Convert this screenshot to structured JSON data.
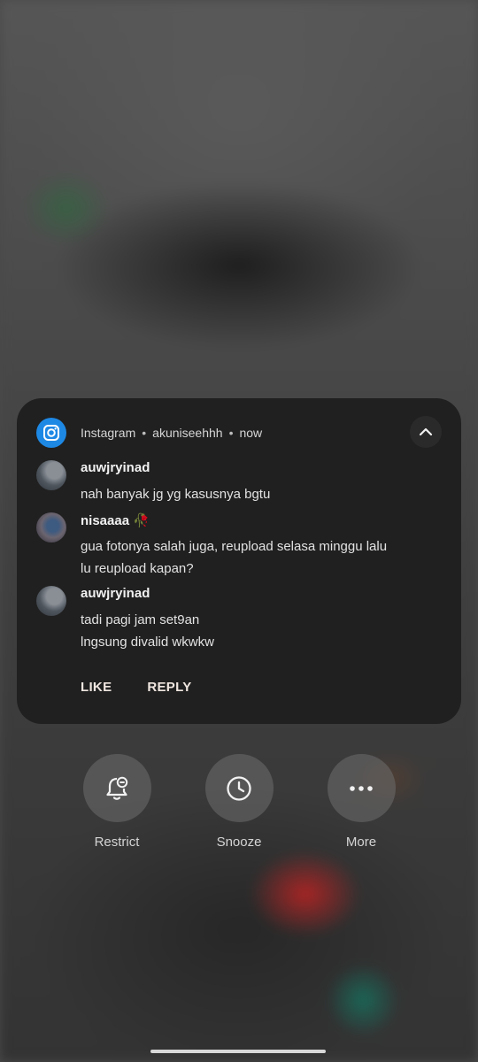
{
  "notification": {
    "app_name": "Instagram",
    "account": "akuniseehhh",
    "time": "now",
    "separator": "•",
    "messages": [
      {
        "sender": "auwjryinad",
        "lines": [
          "nah banyak jg yg kasusnya bgtu"
        ]
      },
      {
        "sender": "nisaaaa 🥀",
        "lines": [
          "gua fotonya salah juga, reupload selasa minggu lalu",
          "lu reupload kapan?"
        ]
      },
      {
        "sender": "auwjryinad",
        "lines": [
          "tadi pagi jam set9an",
          "lngsung divalid wkwkw"
        ]
      }
    ],
    "actions": {
      "like": "LIKE",
      "reply": "REPLY"
    }
  },
  "quick_actions": [
    {
      "label": "Restrict",
      "icon": "bell-minus-icon"
    },
    {
      "label": "Snooze",
      "icon": "clock-icon"
    },
    {
      "label": "More",
      "icon": "more-dots-icon"
    }
  ],
  "colors": {
    "card_bg": "#202020",
    "app_icon_bg": "#1e88e5",
    "background_accent_red": "#be2323",
    "background_accent_teal": "#147864"
  }
}
